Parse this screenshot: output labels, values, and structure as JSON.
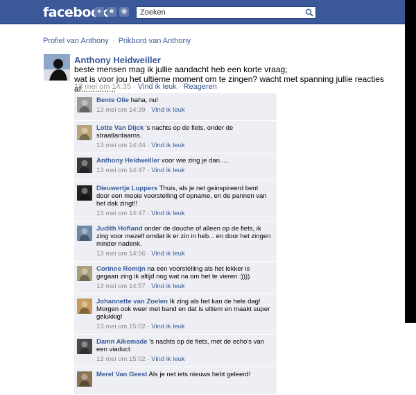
{
  "header": {
    "logo": "facebook",
    "jewels": [
      "friend-requests-icon",
      "messages-icon",
      "notifications-icon"
    ],
    "search_placeholder": "Zoeken",
    "search_value": "Zoeken"
  },
  "breadcrumb": {
    "profile": "Profiel van Anthony",
    "separator": "·",
    "wall": "Prikbord van Anthony"
  },
  "post": {
    "author": "Anthony Heidweiller",
    "line1": "beste mensen mag ik jullie aandacht heb een korte vraag;",
    "line2": "wat is voor jou het ultieme moment om te zingen? wacht met spanning jullie reacties af...............",
    "timestamp": "13 mei om 14:35",
    "dot": "·",
    "like": "Vind ik leuk",
    "comment": "Reageren"
  },
  "comments": [
    {
      "name": "Bente Olie",
      "text": "haha, nu!",
      "time": "13 mei om 14:39",
      "like": "Vind ik leuk",
      "avatar": "#9a9a9a"
    },
    {
      "name": "Lotte Van Dijck",
      "text": "'s nachts op de fiets, onder de straatlantaarns.",
      "time": "13 mei om 14:44",
      "like": "Vind ik leuk",
      "avatar": "#b9a57a"
    },
    {
      "name": "Anthony Heidweiller",
      "text": "voor wie zing je dan.....",
      "time": "13 mei om 14:47",
      "like": "Vind ik leuk",
      "avatar": "#3a3a3a"
    },
    {
      "name": "Dieuwertje Luppers",
      "text": "Thuis, als je net geinspireerd bent door een mooie voorstelling of opname, en de pannen van het dak zingt!!",
      "time": "13 mei om 14:47",
      "like": "Vind ik leuk",
      "avatar": "#222222"
    },
    {
      "name": "Judith Hofland",
      "text": "onder de douche of alleen op de fiets, ik zing voor mezelf omdat ik er zin in heb... en door het zingen minder nadenk.",
      "time": "13 mei om 14:56",
      "like": "Vind ik leuk",
      "avatar": "#6f8aa8"
    },
    {
      "name": "Corinne Romijn",
      "text": "na een voorstelling als het lekker is gegaan zing ik altijd nog wat na om het te vieren :))))",
      "time": "13 mei om 14:57",
      "like": "Vind ik leuk",
      "avatar": "#a9a07a"
    },
    {
      "name": "Johannette van Zoelen",
      "text": "Ik zing als het kan de hele dag! Morgen ook weer met band en dat is ultiem en maakt super gelukkig!",
      "time": "13 mei om 15:02",
      "like": "Vind ik leuk",
      "avatar": "#c89b5c"
    },
    {
      "name": "Damn Alkemade",
      "text": "'s nachts op de fiets, met de echo's van een viaduct",
      "time": "13 mei om 15:02",
      "like": "Vind ik leuk",
      "avatar": "#4a4a4a"
    },
    {
      "name": "Merel Van Geest",
      "text": "Als je net iets nieuws hebt geleerd!",
      "time": "",
      "like": "",
      "avatar": "#8b7355"
    }
  ],
  "colors": {
    "brand": "#3b5998",
    "comment_bg": "#edeff4"
  }
}
